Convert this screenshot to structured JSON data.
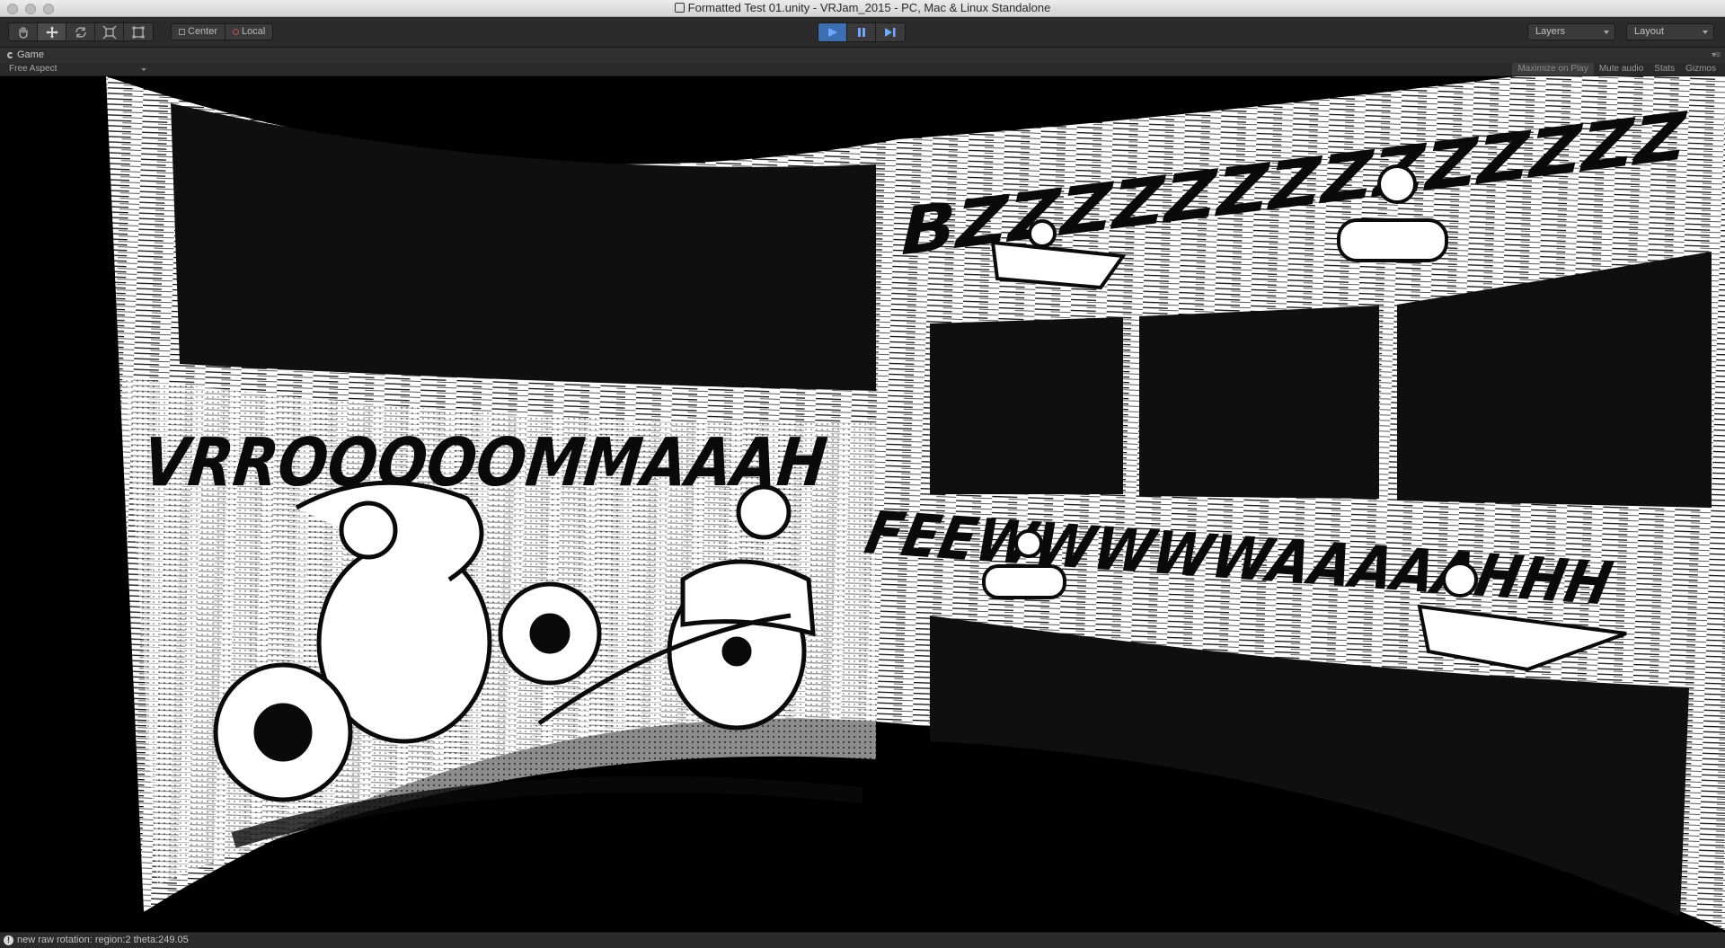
{
  "window": {
    "title": "Formatted Test 01.unity - VRJam_2015 - PC, Mac & Linux Standalone"
  },
  "toolbar": {
    "tools": [
      {
        "name": "hand-tool",
        "icon": "hand-icon"
      },
      {
        "name": "move-tool",
        "icon": "move-icon",
        "active": true
      },
      {
        "name": "rotate-tool",
        "icon": "rotate-icon"
      },
      {
        "name": "scale-tool",
        "icon": "scale-icon"
      },
      {
        "name": "rect-tool",
        "icon": "rect-icon"
      }
    ],
    "pivot_label": "Center",
    "space_label": "Local",
    "play": {
      "active": true
    },
    "layers_label": "Layers",
    "layout_label": "Layout"
  },
  "game_tab": {
    "label": "Game",
    "aspect": "Free Aspect",
    "maximize_on_play": "Maximize on Play",
    "mute_audio": "Mute audio",
    "stats": "Stats",
    "gizmos": "Gizmos"
  },
  "comic": {
    "sfx_left": "VRROOOOOMMAAAH",
    "sfx_top_right": "BZZZZZZZZZZZZZZ",
    "sfx_mid_right": "FEEWWWWWAAAAAHHH"
  },
  "status": {
    "message": "new raw rotation: region:2 theta:249.05"
  },
  "colors": {
    "toolbar_bg": "#2b2b2b",
    "play_active": "#3d6fb0",
    "game_bg": "#000000",
    "panel_bg": "#0f0f0f",
    "paper": "#ffffff"
  }
}
